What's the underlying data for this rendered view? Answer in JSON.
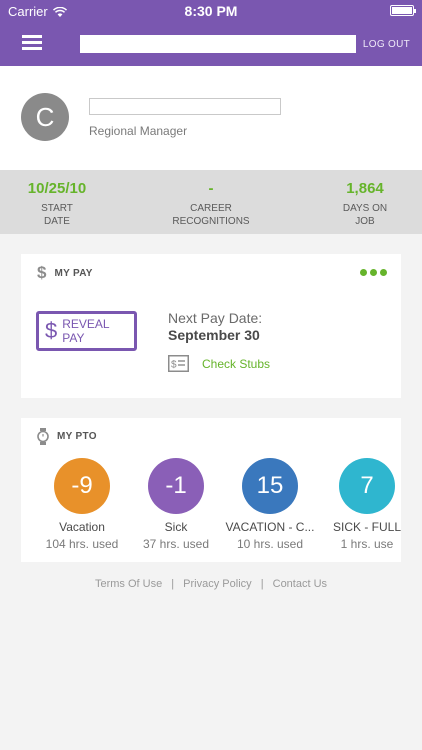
{
  "status_bar": {
    "carrier": "Carrier",
    "time": "8:30 PM"
  },
  "header": {
    "search_value": "",
    "logout_label": "LOG OUT",
    "accent_color": "#7a57b0"
  },
  "profile": {
    "avatar_initial": "C",
    "name_value": "",
    "role": "Regional Manager"
  },
  "stats": [
    {
      "value": "10/25/10",
      "label_line1": "START",
      "label_line2": "DATE"
    },
    {
      "value": "-",
      "label_line1": "CAREER",
      "label_line2": "RECOGNITIONS"
    },
    {
      "value": "1,864",
      "label_line1": "DAYS ON",
      "label_line2": "JOB"
    }
  ],
  "pay": {
    "title": "MY PAY",
    "reveal_label_line1": "REVEAL",
    "reveal_label_line2": "PAY",
    "next_pay_label": "Next Pay Date:",
    "next_pay_date": "September 30",
    "check_stubs_label": "Check Stubs"
  },
  "pto": {
    "title": "MY PTO",
    "items": [
      {
        "value": "-9",
        "name": "Vacation",
        "used": "104 hrs. used",
        "color": "#e8912a"
      },
      {
        "value": "-1",
        "name": "Sick",
        "used": "37 hrs. used",
        "color": "#8a5fb7"
      },
      {
        "value": "15",
        "name": "VACATION - C...",
        "used": "10 hrs. used",
        "color": "#3a78bd"
      },
      {
        "value": "7",
        "name": "SICK - FULL",
        "used": "1 hrs. use",
        "color": "#2fb6cf"
      }
    ]
  },
  "footer": {
    "terms": "Terms Of Use",
    "privacy": "Privacy Policy",
    "contact": "Contact Us",
    "separator": "|"
  }
}
